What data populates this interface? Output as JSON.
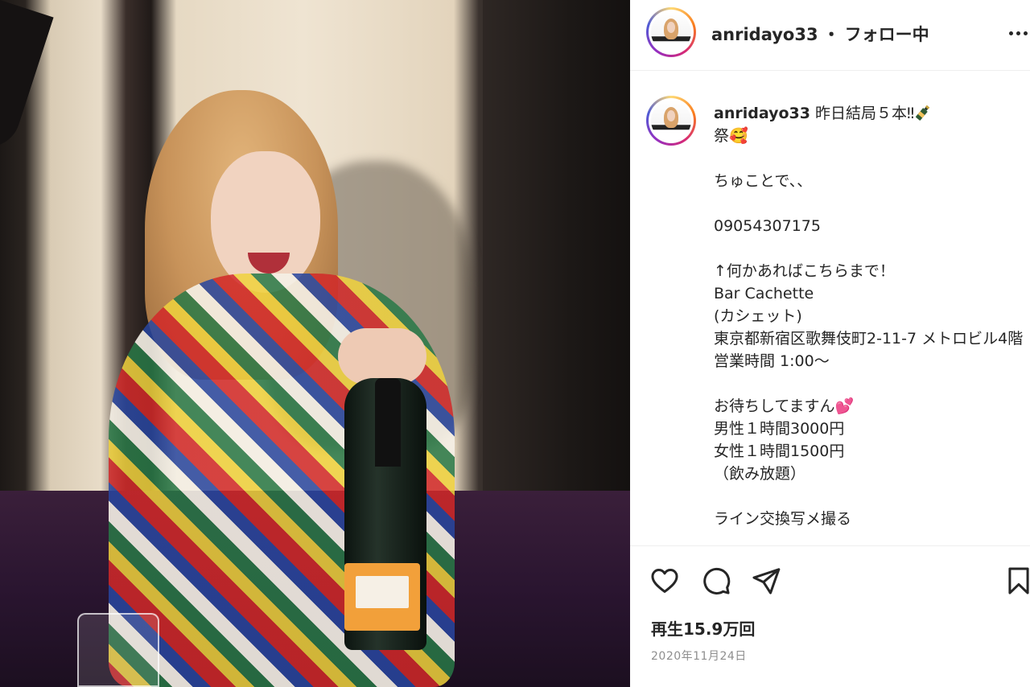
{
  "post": {
    "username": "anridayo33",
    "separator": "・",
    "follow_status": "フォロー中",
    "caption_username": "anridayo33",
    "caption_lines": [
      "昨日結局５本‼︎",
      "祭🥰",
      "",
      "ちゅことで、、",
      "",
      "09054307175",
      "",
      "↑何かあればこちらまで！",
      "Bar Cachette",
      "(カシェット)",
      "東京都新宿区歌舞伎町2-11-7 メトロビル4階",
      "営業時間 1:00〜",
      "",
      "お待ちしてますん💕",
      "男性１時間3000円",
      "女性１時間1500円",
      "（飲み放題）",
      "",
      "ライン交換写メ撮る"
    ],
    "view_count": "再生15.9万回",
    "date": "2020年11月24日"
  },
  "icons": {
    "more": "more-options-icon",
    "like": "heart-icon",
    "comment": "comment-icon",
    "share": "share-paper-plane-icon",
    "save": "bookmark-icon",
    "emoji_bottle": "champagne-bottle-emoji"
  },
  "colors": {
    "avatar_ring": [
      "#feda75",
      "#fa7e1e",
      "#d62976",
      "#962fbf",
      "#4f5bd5"
    ],
    "text_primary": "#262626",
    "text_secondary": "#8e8e8e",
    "divider": "#efefef"
  }
}
